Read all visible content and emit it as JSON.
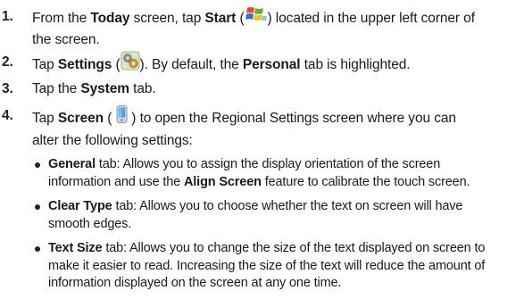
{
  "steps": [
    {
      "num": "1.",
      "pre": "From the ",
      "b1": "Today",
      "mid1": " screen, tap ",
      "b2": "Start",
      "mid2": " (",
      "icon": "windows-start-icon",
      "post1": ") located in the upper left corner of",
      "line2": "the screen."
    },
    {
      "num": "2.",
      "pre": "Tap ",
      "b1": "Settings",
      "mid1": " (",
      "icon": "settings-gears-icon",
      "mid2": "). By default, the ",
      "b2": "Personal",
      "post1": " tab is highlighted."
    },
    {
      "num": "3.",
      "pre": "Tap the ",
      "b1": "System",
      "post1": " tab."
    },
    {
      "num": "4.",
      "pre": "Tap ",
      "b1": "Screen",
      "mid1": " (",
      "icon": "screen-device-icon",
      "post1": ") to open the Regional Settings screen where you can",
      "line2": "alter the following settings:"
    }
  ],
  "bullets": [
    {
      "bold": "General",
      "line1": " tab: Allows you to assign the display orientation of the screen",
      "line2pre": "information and use the ",
      "line2bold": "Align Screen",
      "line2post": " feature to calibrate the touch screen."
    },
    {
      "bold": "Clear Type",
      "line1": " tab: Allows you to choose whether the text on screen will have",
      "line2": "smooth edges."
    },
    {
      "bold": "Text Size",
      "line1": " tab: Allows you to change the size of the text displayed on screen to",
      "line2": "make it easier to read. Increasing the size of the text will reduce the amount of",
      "line3": "information displayed on the screen at any one time."
    }
  ],
  "colors": {
    "text": "#1a1a1a",
    "start_red": "#e8472a",
    "start_green": "#5fb526",
    "start_blue": "#2a6fd6",
    "start_yellow": "#f4c21d"
  }
}
